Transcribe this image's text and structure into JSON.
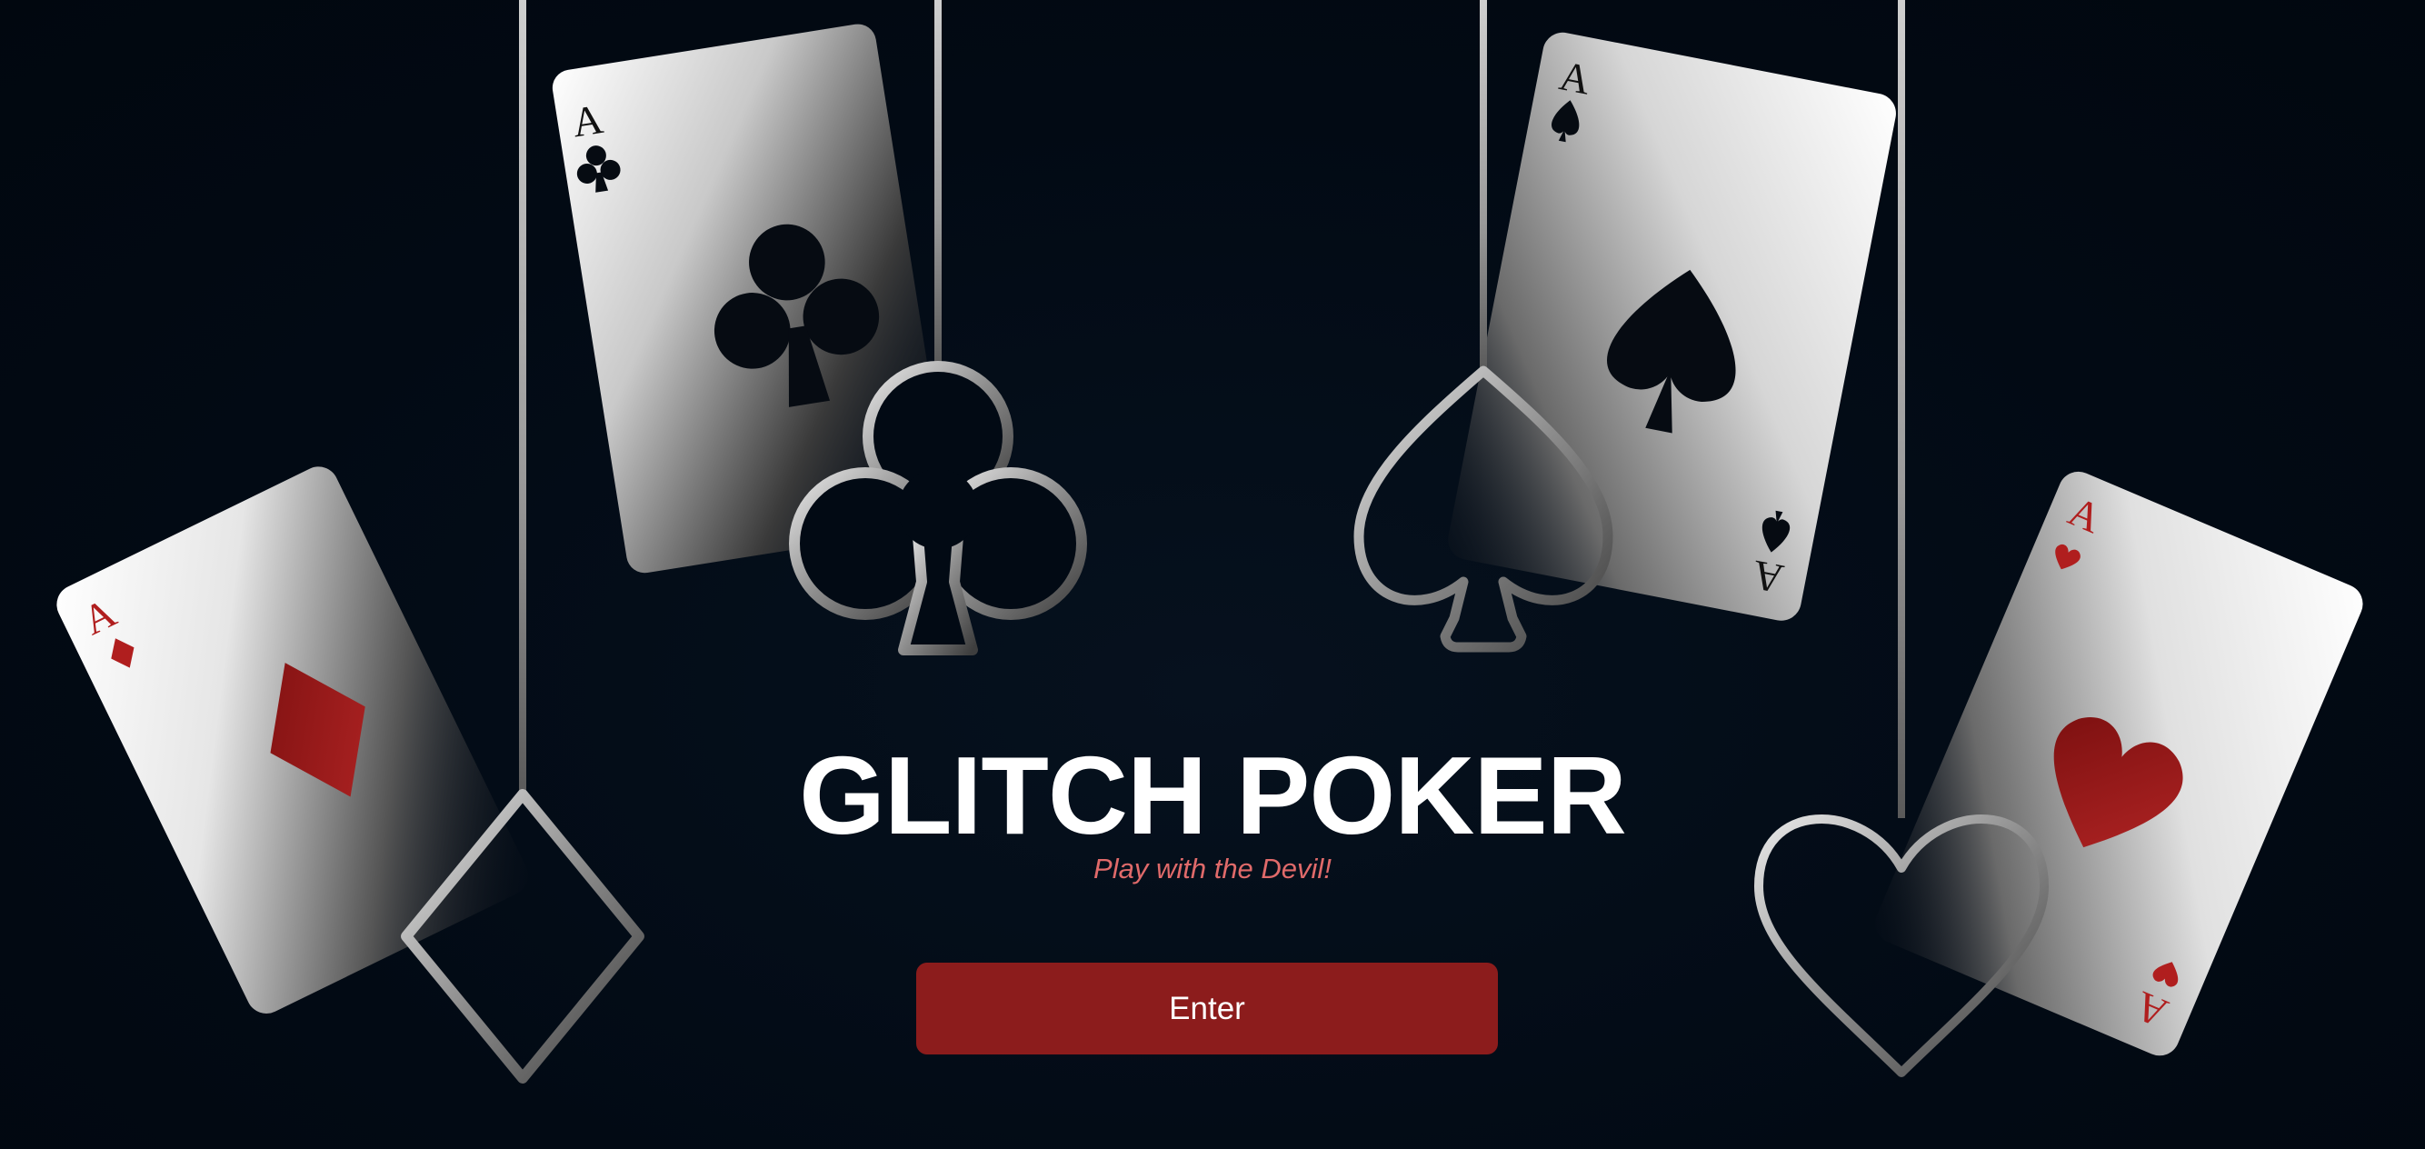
{
  "title": "GLITCH POKER",
  "subtitle": "Play with the Devil!",
  "enter_label": "Enter",
  "colors": {
    "background": "#020a14",
    "button": "#8c1c1c",
    "subtitle": "#e06a6a",
    "card_red": "#a01c1c",
    "card_black": "#050a10"
  },
  "cards": [
    {
      "rank": "A",
      "suit": "diamond"
    },
    {
      "rank": "A",
      "suit": "club"
    },
    {
      "rank": "A",
      "suit": "spade"
    },
    {
      "rank": "A",
      "suit": "heart"
    }
  ],
  "hanging_ornaments": [
    "diamond",
    "club",
    "spade",
    "heart"
  ]
}
